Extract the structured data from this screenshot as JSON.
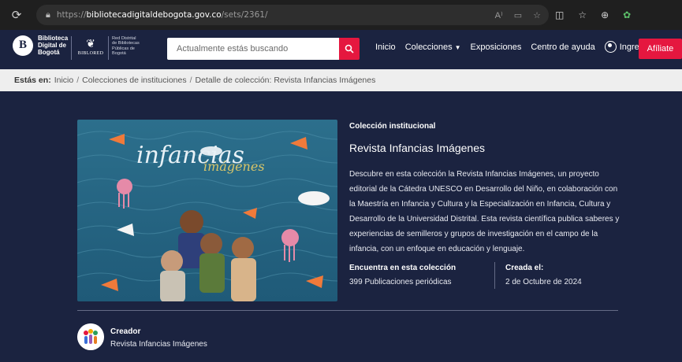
{
  "browser": {
    "url_prefix": "https://",
    "url_domain": "bibliotecadigitaldebogota.gov.co",
    "url_path": "/sets/2361/"
  },
  "header": {
    "logo_text_line1": "Biblioteca",
    "logo_text_line2": "Digital de",
    "logo_text_line3": "Bogotá",
    "logo_letter": "B",
    "biblored_text": "BIBLORED",
    "red_text_line1": "Red Distrital",
    "red_text_line2": "de Bibliotecas",
    "red_text_line3": "Públicas de",
    "red_text_line4": "Bogotá",
    "search_placeholder": "Actualmente estás buscando",
    "nav": {
      "inicio": "Inicio",
      "colecciones": "Colecciones",
      "exposiciones": "Exposiciones",
      "ayuda": "Centro de ayuda",
      "ingresa": "Ingresa"
    },
    "afiliate": "Afíliate"
  },
  "breadcrumb": {
    "prefix": "Estás en:",
    "items": [
      "Inicio",
      "Colecciones de instituciones",
      "Detalle de colección: Revista Infancias Imágenes"
    ]
  },
  "collection": {
    "kicker": "Colección institucional",
    "title": "Revista Infancias Imágenes",
    "cover_title": "infancias",
    "cover_subtitle": "imágenes",
    "description": "Descubre en esta colección la Revista Infancias Imágenes, un proyecto editorial de la Cátedra UNESCO en Desarrollo del Niño, en colaboración con la Maestría en Infancia y Cultura y la Especialización en Infancia, Cultura y Desarrollo de la Universidad Distrital. Esta revista científica publica saberes y experiencias de semilleros y grupos de investigación en el campo de la infancia, con un enfoque en educación y lenguaje.",
    "found_label": "Encuentra en esta colección",
    "found_value": "399 Publicaciones periódicas",
    "created_label": "Creada el:",
    "created_value": "2 de Octubre de 2024",
    "creator_label": "Creador",
    "creator_name": "Revista Infancias Imágenes"
  },
  "colors": {
    "background": "#1b2340",
    "accent": "#e5173f",
    "breadcrumb_bg": "#eeeeee"
  }
}
